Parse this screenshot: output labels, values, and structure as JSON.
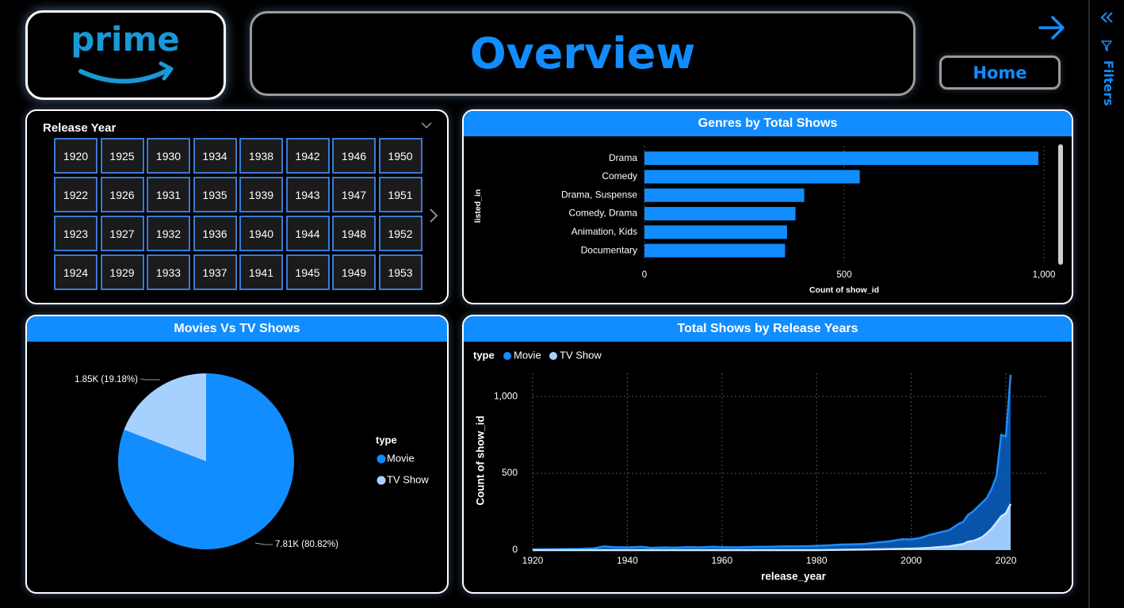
{
  "logo": {
    "text": "prime"
  },
  "header": {
    "title": "Overview",
    "home_label": "Home"
  },
  "filters": {
    "label": "Filters"
  },
  "release_year_slicer": {
    "title": "Release Year",
    "years": [
      [
        "1920",
        "1925",
        "1930",
        "1934",
        "1938",
        "1942",
        "1946",
        "1950"
      ],
      [
        "1922",
        "1926",
        "1931",
        "1935",
        "1939",
        "1943",
        "1947",
        "1951"
      ],
      [
        "1923",
        "1927",
        "1932",
        "1936",
        "1940",
        "1944",
        "1948",
        "1952"
      ],
      [
        "1924",
        "1929",
        "1933",
        "1937",
        "1941",
        "1945",
        "1949",
        "1953"
      ]
    ]
  },
  "colors": {
    "accent": "#118dff",
    "movie": "#118dff",
    "tv_show": "#a6d1ff",
    "card_border": "#ffffff"
  },
  "chart_data": [
    {
      "type": "bar",
      "title": "Genres by Total Shows",
      "categories": [
        "Drama",
        "Comedy",
        "Drama, Suspense",
        "Comedy, Drama",
        "Animation, Kids",
        "Documentary"
      ],
      "values": [
        986,
        539,
        400,
        378,
        357,
        352
      ],
      "xlabel": "Count of show_id",
      "ylabel": "listed_in",
      "xticks": [
        "0",
        "500",
        "1,000"
      ],
      "xlim": [
        0,
        1000
      ],
      "grid": true
    },
    {
      "type": "pie",
      "title": "Movies Vs TV Shows",
      "legend_title": "type",
      "legend_position": "right",
      "slices": [
        {
          "name": "Movie",
          "value": 7810,
          "label": "7.81K (80.82%)"
        },
        {
          "name": "TV Show",
          "value": 1850,
          "label": "1.85K (19.18%)"
        }
      ]
    },
    {
      "type": "area",
      "title": "Total Shows by Release Years",
      "legend_title": "type",
      "legend_position": "top-left",
      "xlabel": "release_year",
      "ylabel": "Count of show_id",
      "xticks": [
        "1920",
        "1940",
        "1960",
        "1980",
        "2000",
        "2020"
      ],
      "yticks": [
        "0",
        "500",
        "1,000"
      ],
      "xlim": [
        1920,
        2021
      ],
      "ylim": [
        0,
        1150
      ],
      "grid": true,
      "x": [
        1920,
        1925,
        1930,
        1933,
        1935,
        1937,
        1940,
        1943,
        1945,
        1948,
        1950,
        1953,
        1955,
        1958,
        1960,
        1963,
        1965,
        1968,
        1970,
        1973,
        1975,
        1978,
        1980,
        1983,
        1985,
        1988,
        1990,
        1993,
        1995,
        1998,
        2000,
        2002,
        2004,
        2006,
        2008,
        2010,
        2011,
        2012,
        2013,
        2014,
        2015,
        2016,
        2017,
        2018,
        2019,
        2020,
        2021
      ],
      "series": [
        {
          "name": "Movie",
          "values": [
            5,
            6,
            8,
            12,
            25,
            20,
            18,
            22,
            15,
            18,
            16,
            20,
            18,
            22,
            20,
            18,
            20,
            22,
            22,
            25,
            24,
            26,
            28,
            32,
            36,
            38,
            40,
            50,
            56,
            70,
            70,
            80,
            100,
            115,
            130,
            170,
            185,
            230,
            250,
            280,
            310,
            340,
            400,
            480,
            750,
            740,
            1140
          ]
        },
        {
          "name": "TV Show",
          "values": [
            0,
            0,
            0,
            0,
            0,
            0,
            0,
            0,
            0,
            0,
            0,
            0,
            0,
            0,
            0,
            0,
            0,
            0,
            0,
            0,
            0,
            0,
            0,
            1,
            2,
            3,
            4,
            5,
            6,
            8,
            10,
            12,
            15,
            20,
            25,
            35,
            40,
            55,
            60,
            70,
            85,
            110,
            140,
            180,
            220,
            240,
            300
          ]
        }
      ]
    }
  ]
}
